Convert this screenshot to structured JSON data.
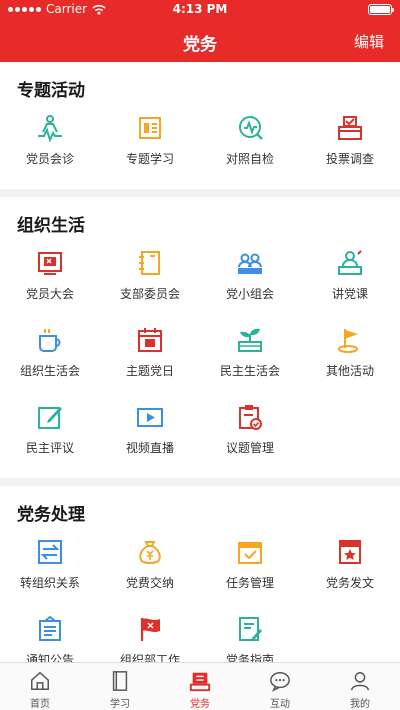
{
  "status_bar": {
    "carrier": "Carrier",
    "time": "4:13 PM"
  },
  "nav": {
    "title": "党务",
    "edit": "编辑"
  },
  "colors": {
    "brand": "#e72b29",
    "teal": "#2bb39a",
    "orange": "#f5a623",
    "blue": "#3d8fe0",
    "red": "#d9342b"
  },
  "sections": [
    {
      "title": "专题活动",
      "items": [
        {
          "label": "党员会诊",
          "icon": "consultation-icon"
        },
        {
          "label": "专题学习",
          "icon": "study-icon"
        },
        {
          "label": "对照自检",
          "icon": "self-check-icon"
        },
        {
          "label": "投票调查",
          "icon": "ballot-box-icon"
        }
      ]
    },
    {
      "title": "组织生活",
      "items": [
        {
          "label": "党员大会",
          "icon": "party-flag-board-icon"
        },
        {
          "label": "支部委员会",
          "icon": "notebook-icon"
        },
        {
          "label": "党小组会",
          "icon": "group-meeting-icon"
        },
        {
          "label": "讲党课",
          "icon": "lecture-icon"
        },
        {
          "label": "组织生活会",
          "icon": "cup-icon"
        },
        {
          "label": "主题党日",
          "icon": "calendar-flag-icon"
        },
        {
          "label": "民主生活会",
          "icon": "sprout-icon"
        },
        {
          "label": "其他活动",
          "icon": "flag-icon"
        },
        {
          "label": "民主评议",
          "icon": "edit-icon"
        },
        {
          "label": "视频直播",
          "icon": "video-icon"
        },
        {
          "label": "议题管理",
          "icon": "clipboard-check-icon"
        }
      ]
    },
    {
      "title": "党务处理",
      "items": [
        {
          "label": "转组织关系",
          "icon": "transfer-icon"
        },
        {
          "label": "党费交纳",
          "icon": "money-bag-icon"
        },
        {
          "label": "任务管理",
          "icon": "task-icon"
        },
        {
          "label": "党务发文",
          "icon": "document-star-icon"
        },
        {
          "label": "通知公告",
          "icon": "notice-icon"
        },
        {
          "label": "组织部工作",
          "icon": "party-flag-icon"
        },
        {
          "label": "党务指南",
          "icon": "guide-icon"
        }
      ]
    }
  ],
  "tabs": [
    {
      "label": "首页",
      "icon": "home-icon",
      "active": false
    },
    {
      "label": "学习",
      "icon": "book-icon",
      "active": false
    },
    {
      "label": "党务",
      "icon": "party-affairs-icon",
      "active": true
    },
    {
      "label": "互动",
      "icon": "chat-icon",
      "active": false
    },
    {
      "label": "我的",
      "icon": "person-icon",
      "active": false
    }
  ]
}
